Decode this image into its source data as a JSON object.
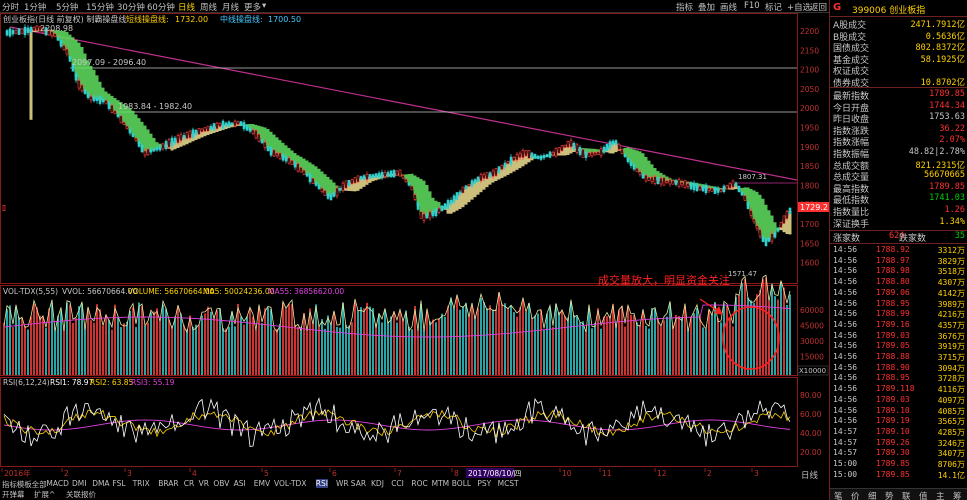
{
  "toolbar": {
    "periods": [
      "分时",
      "1分钟",
      "5分钟",
      "15分钟",
      "30分钟",
      "60分钟",
      "日线",
      "周线",
      "月线",
      "更多"
    ],
    "active_period": "日线",
    "right_items": [
      "指标",
      "叠加",
      "画线",
      "F10",
      "标记",
      "+自选",
      "返回"
    ]
  },
  "main_chart": {
    "title": "创业板指(日线 前复权) 制霸操盘线",
    "ind1_label": "短线操盘线:",
    "ind1_value": "1732.00",
    "ind2_label": "中线操盘线:",
    "ind2_value": "1700.50",
    "annotations": {
      "high": "2208.98",
      "line1": "2097.09 - 2096.40",
      "line2": "1983.84 - 1982.40",
      "mid": "1807.31",
      "low": "1571.47",
      "price_tag": "1729.2"
    },
    "y_ticks": [
      "2200",
      "2150",
      "2100",
      "2050",
      "2000",
      "1950",
      "1900",
      "1850",
      "1800",
      "1750",
      "1700",
      "1650",
      "1600"
    ]
  },
  "vol_panel": {
    "title": "VOL-TDX(5,55)",
    "vvol": "VVOL: 56670664.00",
    "volume": "VOLUME: 56670664.00",
    "ma5": "MA5: 50024236.00",
    "ma55": "MA55: 36856620.00",
    "y_ticks": [
      "60000",
      "45000",
      "30000",
      "15000"
    ],
    "unit": "X10000",
    "callout": "成交量放大，明显资金关注"
  },
  "rsi_panel": {
    "title": "RSI(6,12,24)",
    "rsi1": "RSI1: 78.97",
    "rsi2": "RSI2: 63.85",
    "rsi3": "RSI3: 55.19",
    "y_ticks": [
      "80.00",
      "60.00",
      "40.00",
      "20.00"
    ]
  },
  "x_axis": {
    "labels": [
      "2016年",
      "2",
      "3",
      "4",
      "5",
      "6",
      "7",
      "8",
      "9",
      "10",
      "11",
      "12",
      "2",
      "3"
    ],
    "cursor_date": "2017/08/10/四"
  },
  "bottom": {
    "tabs_row1": [
      "指标",
      "模板",
      "全部",
      "MACD",
      "DMI",
      "DMA",
      "FSL",
      "TRIX",
      "BRAR",
      "CR",
      "VR",
      "OBV",
      "ASI",
      "EMV",
      "VOL-TDX",
      "RSI",
      "WR",
      "SAR",
      "KDJ",
      "CCI",
      "ROC",
      "MTM",
      "BOLL",
      "PSY",
      "MCST"
    ],
    "active_tab": "RSI",
    "tabs_row2": [
      "开弹幕",
      "扩展^",
      "关联报价"
    ],
    "right_label": "日线"
  },
  "quote": {
    "g_label": "G",
    "code": "399006 创业板指",
    "rows1": [
      {
        "k": "A股成交",
        "v": "2471.7912亿",
        "c": "#ffd200"
      },
      {
        "k": "B股成交",
        "v": "0.5636亿",
        "c": "#ffd200"
      },
      {
        "k": "国债成交",
        "v": "802.8372亿",
        "c": "#ffd200"
      },
      {
        "k": "基金成交",
        "v": "58.1925亿",
        "c": "#ffd200"
      },
      {
        "k": "权证成交",
        "v": "",
        "c": "#ffd200"
      },
      {
        "k": "债券成交",
        "v": "10.8702亿",
        "c": "#ffd200"
      }
    ],
    "rows2": [
      {
        "k": "最新指数",
        "v": "1789.85",
        "c": "#ff3030"
      },
      {
        "k": "今日开盘",
        "v": "1744.34",
        "c": "#ff3030"
      },
      {
        "k": "昨日收盘",
        "v": "1753.63",
        "c": "#c8c8c8"
      },
      {
        "k": "指数涨跌",
        "v": "36.22",
        "c": "#ff3030"
      },
      {
        "k": "指数涨幅",
        "v": "2.07%",
        "c": "#ff3030"
      },
      {
        "k": "指数振幅",
        "v": "48.82|2.78%",
        "c": "#c8c8c8"
      },
      {
        "k": "总成交额",
        "v": "821.2315亿",
        "c": "#ffd200"
      },
      {
        "k": "总成交量",
        "v": "56670665",
        "c": "#ffd200"
      },
      {
        "k": "最高指数",
        "v": "1789.85",
        "c": "#ff3030"
      },
      {
        "k": "最低指数",
        "v": "1741.03",
        "c": "#00d000"
      },
      {
        "k": "指数量比",
        "v": "1.26",
        "c": "#ff3030"
      },
      {
        "k": "深证换手",
        "v": "1.34%",
        "c": "#ffd200"
      }
    ],
    "up_label": "涨家数",
    "up_count": "624",
    "down_label": "跌家数",
    "down_count": "35",
    "ticks": [
      {
        "t": "14:56",
        "p": "1788.92",
        "v": "3312万"
      },
      {
        "t": "14:56",
        "p": "1788.97",
        "v": "3829万"
      },
      {
        "t": "14:56",
        "p": "1788.98",
        "v": "3518万"
      },
      {
        "t": "14:56",
        "p": "1788.80",
        "v": "4307万"
      },
      {
        "t": "14:56",
        "p": "1789.06",
        "v": "4142万"
      },
      {
        "t": "14:56",
        "p": "1788.95",
        "v": "3989万"
      },
      {
        "t": "14:56",
        "p": "1788.99",
        "v": "4216万"
      },
      {
        "t": "14:56",
        "p": "1789.16",
        "v": "4357万"
      },
      {
        "t": "14:56",
        "p": "1789.03",
        "v": "3676万"
      },
      {
        "t": "14:56",
        "p": "1789.05",
        "v": "3919万"
      },
      {
        "t": "14:56",
        "p": "1788.88",
        "v": "3715万"
      },
      {
        "t": "14:56",
        "p": "1788.90",
        "v": "3094万"
      },
      {
        "t": "14:56",
        "p": "1788.95",
        "v": "3728万"
      },
      {
        "t": "14:56",
        "p": "1789.118",
        "v": "4116万"
      },
      {
        "t": "14:56",
        "p": "1789.03",
        "v": "4097万"
      },
      {
        "t": "14:56",
        "p": "1789.10",
        "v": "4085万"
      },
      {
        "t": "14:56",
        "p": "1789.19",
        "v": "3565万"
      },
      {
        "t": "14:57",
        "p": "1789.10",
        "v": "4285万"
      },
      {
        "t": "14:57",
        "p": "1789.26",
        "v": "3246万"
      },
      {
        "t": "14:57",
        "p": "1789.30",
        "v": "3407万"
      },
      {
        "t": "15:00",
        "p": "1789.85",
        "v": "8706万"
      },
      {
        "t": "15:00",
        "p": "1789.85",
        "v": "14.1亿"
      }
    ],
    "footer": [
      "笔",
      "价",
      "细",
      "势",
      "联",
      "值",
      "主",
      "筹"
    ]
  }
}
